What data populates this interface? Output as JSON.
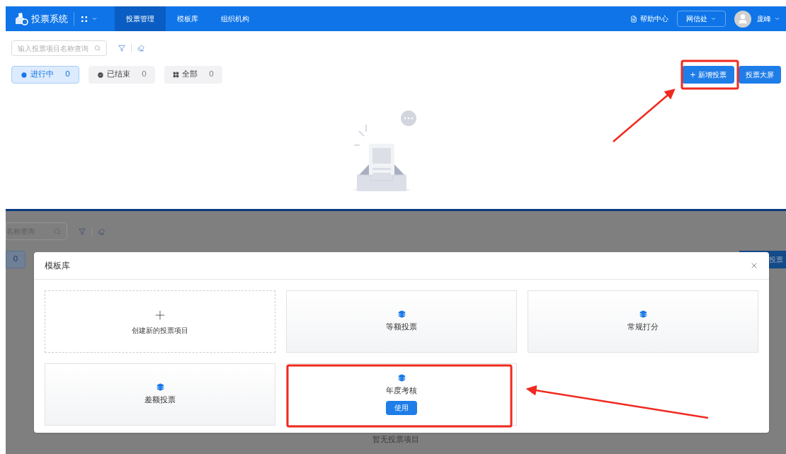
{
  "top": {
    "app_title": "投票系统",
    "nav": [
      {
        "label": "投票管理",
        "selected": true
      },
      {
        "label": "模板库",
        "selected": false
      },
      {
        "label": "组织机构",
        "selected": false
      }
    ],
    "help": "帮助中心",
    "org": "网信处",
    "user": "庞峰",
    "search": {
      "placeholder": "输入投票项目名称查询"
    },
    "filters": [
      {
        "kind": "ongoing",
        "label": "进行中",
        "count": "0",
        "selected": true
      },
      {
        "kind": "ended",
        "label": "已结束",
        "count": "0",
        "selected": false
      },
      {
        "kind": "all",
        "label": "全部",
        "count": "0",
        "selected": false
      }
    ],
    "buttons": [
      "+ 新增投票",
      "投票大屏"
    ]
  },
  "bottom": {
    "search_placeholder": "名称查询",
    "count": "0",
    "button": "投票",
    "empty_text": "暂无投票项目",
    "modal": {
      "title": "模板库",
      "cards": [
        {
          "kind": "create",
          "label": "创建新的投票项目"
        },
        {
          "kind": "template",
          "label": "等额投票"
        },
        {
          "kind": "template",
          "label": "常规打分"
        },
        {
          "kind": "template",
          "label": "差额投票"
        },
        {
          "kind": "template",
          "label": "年度考核",
          "action": "使用"
        }
      ]
    }
  }
}
